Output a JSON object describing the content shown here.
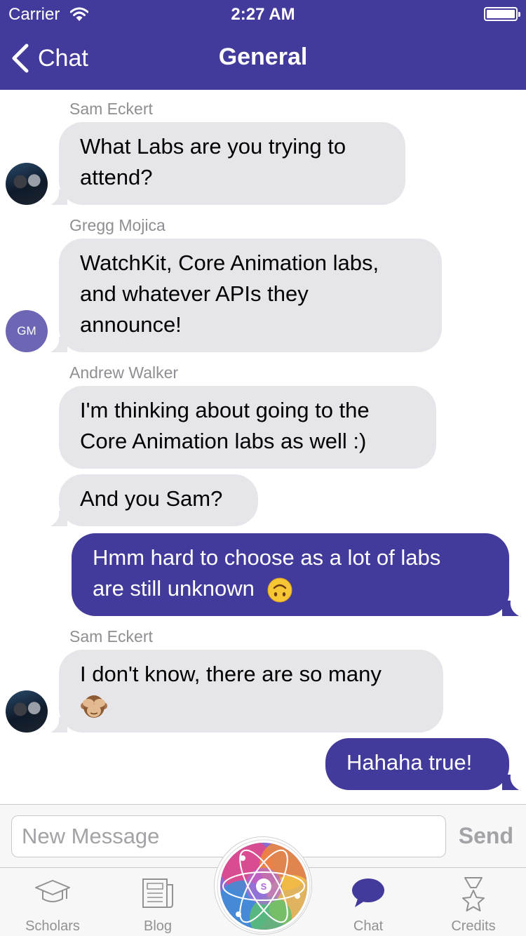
{
  "status_bar": {
    "carrier": "Carrier",
    "time": "2:27 AM",
    "battery_level": 1.0
  },
  "nav": {
    "back_label": "Chat",
    "title": "General"
  },
  "messages": [
    {
      "sender": "Sam Eckert",
      "text_lines": [
        "What Labs are you trying to",
        "attend?"
      ],
      "direction": "incoming",
      "avatar": "photo"
    },
    {
      "sender": "Gregg Mojica",
      "text_lines": [
        "WatchKit, Core Animation labs,",
        "and whatever APIs they",
        "announce!"
      ],
      "direction": "incoming",
      "avatar_initials": "GM"
    },
    {
      "sender": "Andrew Walker",
      "text_lines": [
        "I'm thinking about going to the",
        "Core Animation labs as well :)"
      ],
      "direction": "incoming"
    },
    {
      "text_lines": [
        "And you Sam?"
      ],
      "direction": "incoming"
    },
    {
      "text_lines": [
        "Hmm hard to choose as a lot of labs",
        "are still unknown"
      ],
      "direction": "outgoing",
      "emoji_icon": "upside-down-face-icon"
    },
    {
      "sender": "Sam Eckert",
      "text_lines": [
        "I don't know, there are so many"
      ],
      "direction": "incoming",
      "avatar": "photo",
      "emoji_icon": "see-no-evil-monkey-icon"
    },
    {
      "text_lines": [
        "Hahaha true!"
      ],
      "direction": "outgoing"
    }
  ],
  "composer": {
    "placeholder": "New Message",
    "value": "",
    "send_label": "Send"
  },
  "tabs": [
    {
      "label": "Scholars",
      "icon": "graduation-cap-icon"
    },
    {
      "label": "Blog",
      "icon": "newspaper-icon"
    },
    {
      "label": "",
      "icon": "atom-logo-icon"
    },
    {
      "label": "Chat",
      "icon": "chat-bubble-icon",
      "active": true
    },
    {
      "label": "Credits",
      "icon": "star-award-icon"
    }
  ],
  "colors": {
    "brand": "#433b9b",
    "incoming_bubble": "#e6e5ea",
    "sender_name": "#8e8e93",
    "tab_inactive": "#929292"
  }
}
